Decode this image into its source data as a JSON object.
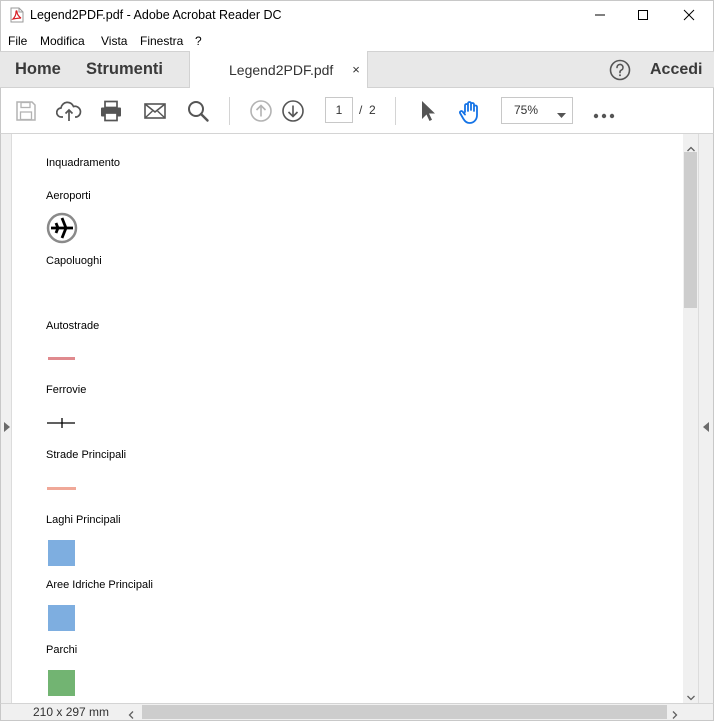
{
  "window": {
    "title": "Legend2PDF.pdf - Adobe Acrobat Reader DC",
    "accent": "#d71f26"
  },
  "menu": {
    "items": [
      "File",
      "Modifica",
      "Vista",
      "Finestra",
      "?"
    ]
  },
  "tabs": {
    "home": "Home",
    "tools": "Strumenti",
    "document": "Legend2PDF.pdf",
    "close": "×",
    "signin": "Accedi"
  },
  "toolbar": {
    "icons": [
      "save-icon",
      "cloud-upload-icon",
      "print-icon",
      "email-icon",
      "search-icon",
      "page-up-icon",
      "page-down-icon",
      "select-cursor-icon",
      "hand-tool-icon",
      "more-icon"
    ],
    "page_current": "1",
    "page_separator": "/",
    "page_total": "2",
    "zoom": "75%",
    "hand_color": "#1473e6"
  },
  "legend": {
    "items": [
      {
        "label": "Inquadramento"
      },
      {
        "label": "Aeroporti",
        "symbol": "airport-icon"
      },
      {
        "label": "Capoluoghi"
      },
      {
        "label": "Autostrade",
        "symbol": "line",
        "color": "#e08a8e"
      },
      {
        "label": "Ferrovie",
        "symbol": "railway-line",
        "color": "#000000"
      },
      {
        "label": "Strade Principali",
        "symbol": "line",
        "color": "#f0a898"
      },
      {
        "label": "Laghi Principali",
        "symbol": "square",
        "color": "#7eaee0"
      },
      {
        "label": "Aree Idriche Principali",
        "symbol": "square",
        "color": "#7eaee0"
      },
      {
        "label": "Parchi",
        "symbol": "square",
        "color": "#72b472"
      }
    ]
  },
  "status": {
    "page_size": "210 x 297 mm"
  }
}
